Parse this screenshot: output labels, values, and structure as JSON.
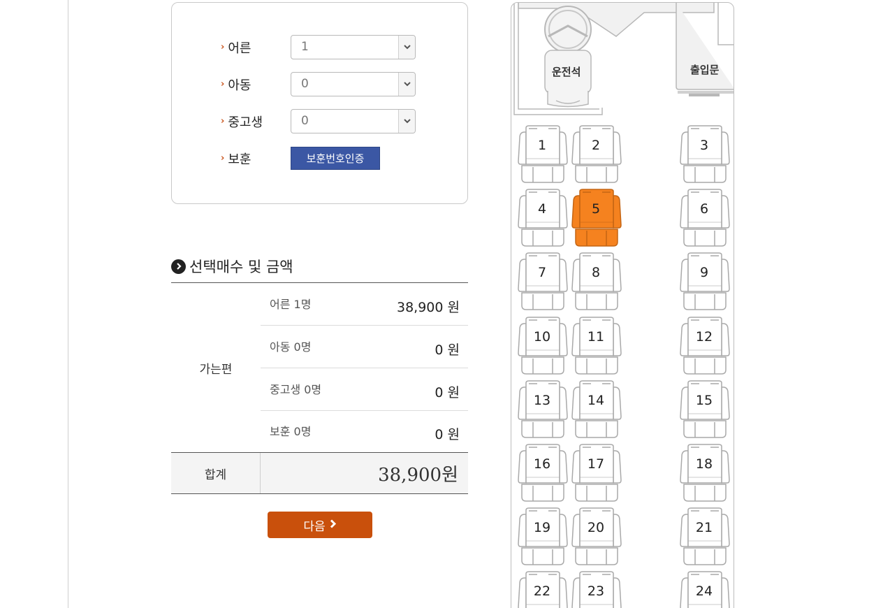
{
  "passengers": {
    "rows": [
      {
        "label": "어른",
        "value": "1"
      },
      {
        "label": "아동",
        "value": "0"
      },
      {
        "label": "중고생",
        "value": "0"
      }
    ],
    "veteran_label": "보훈",
    "veteran_button": "보훈번호인증"
  },
  "summary": {
    "title": "선택매수 및 금액",
    "route": "가는편",
    "fares": [
      {
        "label": "어른 1명",
        "amount": "38,900 원"
      },
      {
        "label": "아동 0명",
        "amount": "0 원"
      },
      {
        "label": "중고생 0명",
        "amount": "0 원"
      },
      {
        "label": "보훈 0명",
        "amount": "0 원"
      }
    ],
    "total_label": "합계",
    "total_value": "38,900원"
  },
  "next_button": "다음",
  "bus": {
    "driver_label": "운전석",
    "door_label": "출입문",
    "seats": [
      "1",
      "2",
      "3",
      "4",
      "5",
      "6",
      "7",
      "8",
      "9",
      "10",
      "11",
      "12",
      "13",
      "14",
      "15",
      "16",
      "17",
      "18",
      "19",
      "20",
      "21",
      "22",
      "23",
      "24"
    ],
    "selected_seat": "5"
  },
  "colors": {
    "accent": "#c9500c",
    "selected_seat": "#f5821f",
    "auth_button": "#3b57a4"
  }
}
